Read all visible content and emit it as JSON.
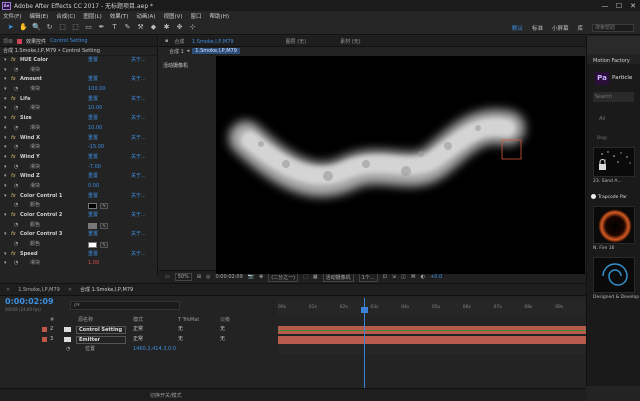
{
  "window": {
    "title": "Adobe After Effects CC 2017 - 无标题项目.aep *",
    "minimize": "—",
    "maximize": "☐",
    "close": "✕"
  },
  "menu": [
    "文件(F)",
    "编辑(E)",
    "合成(C)",
    "图层(L)",
    "效果(T)",
    "动画(A)",
    "视图(V)",
    "窗口",
    "帮助(H)"
  ],
  "toolbar": {
    "tools": [
      "➤",
      "✋",
      "🔍",
      "↻",
      "⬚",
      "⬚",
      "▭",
      "✒",
      "T",
      "✎",
      "⚒",
      "◆",
      "✱",
      "✥",
      "⊹"
    ],
    "workspaces": [
      "默认",
      "标准",
      "小屏幕",
      "库"
    ],
    "active_workspace": "默认",
    "search_placeholder": "搜索帮助"
  },
  "effect_panel": {
    "tab_project": "项目",
    "tab_effects": "效果控件",
    "tab_layer": "Control Setting",
    "breadcrumb": "合成 1.Smoke,I,P,M79 • Control Setting",
    "reset": "重置",
    "about": "关于...",
    "rows": [
      {
        "type": "effect",
        "name": "HUE Color"
      },
      {
        "type": "param",
        "name": "滑块",
        "value": ""
      },
      {
        "type": "effect",
        "name": "Amount"
      },
      {
        "type": "param",
        "name": "滑块",
        "value": "100.00"
      },
      {
        "type": "effect",
        "name": "Life"
      },
      {
        "type": "param",
        "name": "滑块",
        "value": "10.00"
      },
      {
        "type": "effect",
        "name": "Size"
      },
      {
        "type": "param",
        "name": "滑块",
        "value": "10.00"
      },
      {
        "type": "effect",
        "name": "Wind X"
      },
      {
        "type": "param",
        "name": "滑块",
        "value": "-15.00"
      },
      {
        "type": "effect",
        "name": "Wind Y"
      },
      {
        "type": "param",
        "name": "滑块",
        "value": "-7.00"
      },
      {
        "type": "effect",
        "name": "Wind Z"
      },
      {
        "type": "param",
        "name": "滑块",
        "value": "0.00"
      },
      {
        "type": "effect",
        "name": "Color Control 1"
      },
      {
        "type": "color",
        "name": "颜色",
        "swatch": "#000000"
      },
      {
        "type": "effect",
        "name": "Color Control 2"
      },
      {
        "type": "color",
        "name": "颜色",
        "swatch": "#777777"
      },
      {
        "type": "effect",
        "name": "Color Control 3"
      },
      {
        "type": "color",
        "name": "颜色",
        "swatch": "#ffffff"
      },
      {
        "type": "effect",
        "name": "Speed"
      },
      {
        "type": "param",
        "name": "滑块",
        "value": "1.00",
        "highlight": true
      }
    ],
    "fx_glyph": "fx",
    "twirl": "▾",
    "stopwatch": "◔",
    "eyedropper": "✎"
  },
  "composition": {
    "tab_label": "合成",
    "tab_name": "1.Smoke,I,P,M79",
    "tab_layer": "图层 (无)",
    "tab_footage": "素材 (无)",
    "sub_comp": "合成 1",
    "sub_layer": "1.Smoke,I,P,M79",
    "active_camera_label": "活动摄像机",
    "zoom": "50%",
    "timecode": "0:00:02:09",
    "resolution": "(二分之一)",
    "camera": "活动摄像机",
    "views": "1个...",
    "exposure": "+0.0"
  },
  "right_panel": {
    "title": "Motion Factory",
    "brand": "Particle",
    "brand_glyph": "Pa",
    "search": "Search",
    "btn1": "Ali",
    "btn2": "Begi",
    "thumb1_caption": "23. Sand A...",
    "section": "Trapcode Par",
    "thumb2_caption": "N. Fire 16",
    "thumb3_caption": "Designed & Develop"
  },
  "timeline": {
    "tab1": "1.Smoke,I,P,M79",
    "tab2": "合成 1.Smoke,I,P,M79",
    "timecode": "0:00:02:09",
    "timecode_sub": "00059 (24.00 fps)",
    "search_placeholder": "ρ▾",
    "columns": {
      "num": "#",
      "name": "源名称",
      "mode": "模式",
      "trkmat": "T TrkMat",
      "parent": "父级"
    },
    "layers": [
      {
        "num": "2",
        "name": "Control Setting",
        "mode": "正常",
        "trkmat": "无",
        "parent": "无"
      },
      {
        "num": "3",
        "name": "Emitter",
        "mode": "正常",
        "trkmat": "无",
        "parent": "无"
      }
    ],
    "property": {
      "name": "位置",
      "value": "1460.2,414.3,0.0"
    },
    "ruler_ticks": [
      "00s",
      "01s",
      "02s",
      "03s",
      "04s",
      "05s",
      "06s",
      "07s",
      "08s",
      "09s"
    ],
    "status": "切换开关/模式"
  }
}
